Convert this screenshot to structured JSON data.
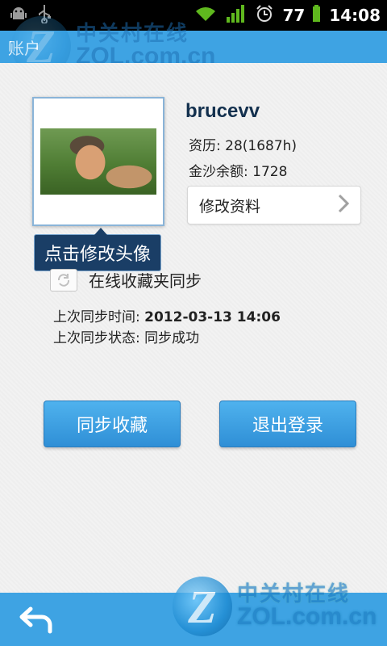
{
  "status_bar": {
    "battery": "77",
    "time": "14:08",
    "icons": [
      "android-debug-icon",
      "usb-icon",
      "wifi-icon",
      "signal-icon",
      "alarm-icon",
      "battery-icon"
    ]
  },
  "title_bar": {
    "title": "账户"
  },
  "watermark": {
    "cn": "中关村在线",
    "en": "ZOL.com.cn",
    "logo": "Z"
  },
  "profile": {
    "username": "brucevv",
    "qualification": "资历: 28(1687h)",
    "gold_balance": "金沙余额: 1728",
    "edit_label": "修改资料",
    "avatar_tip": "点击修改头像"
  },
  "sync": {
    "checkbox_label": "在线收藏夹同步",
    "last_time_label": "上次同步时间: ",
    "last_time_value": "2012-03-13 14:06",
    "last_status_label": "上次同步状态: ",
    "last_status_value": "同步成功"
  },
  "buttons": {
    "sync": "同步收藏",
    "logout": "退出登录"
  },
  "colors": {
    "accent": "#3ea3e3",
    "button": "#3a9ce0",
    "tooltip": "#1a3e66"
  }
}
